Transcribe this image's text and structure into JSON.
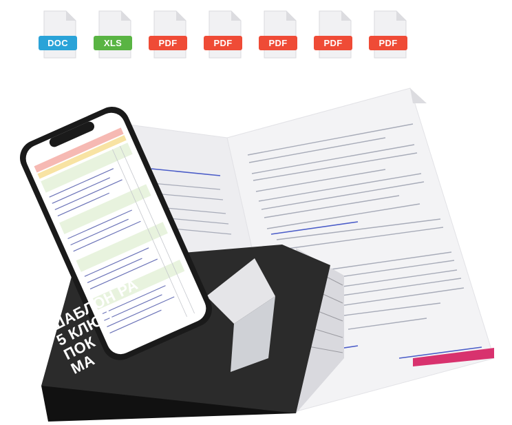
{
  "file_icons": [
    {
      "label": "DOC",
      "color": "#2aa3d8"
    },
    {
      "label": "XLS",
      "color": "#59b443"
    },
    {
      "label": "PDF",
      "color": "#ef4b36"
    },
    {
      "label": "PDF",
      "color": "#ef4b36"
    },
    {
      "label": "PDF",
      "color": "#ef4b36"
    },
    {
      "label": "PDF",
      "color": "#ef4b36"
    },
    {
      "label": "PDF",
      "color": "#ef4b36"
    }
  ],
  "book_cover": {
    "lines": [
      "ШАБЛОН РА",
      "5 КЛЮЧ",
      "ПОК",
      "МА"
    ]
  },
  "colors": {
    "cover_dark": "#2b2b2b",
    "page_paper": "#f3f3f5",
    "phone_body": "#1a1a1a",
    "accent_pink": "#d8326e"
  }
}
